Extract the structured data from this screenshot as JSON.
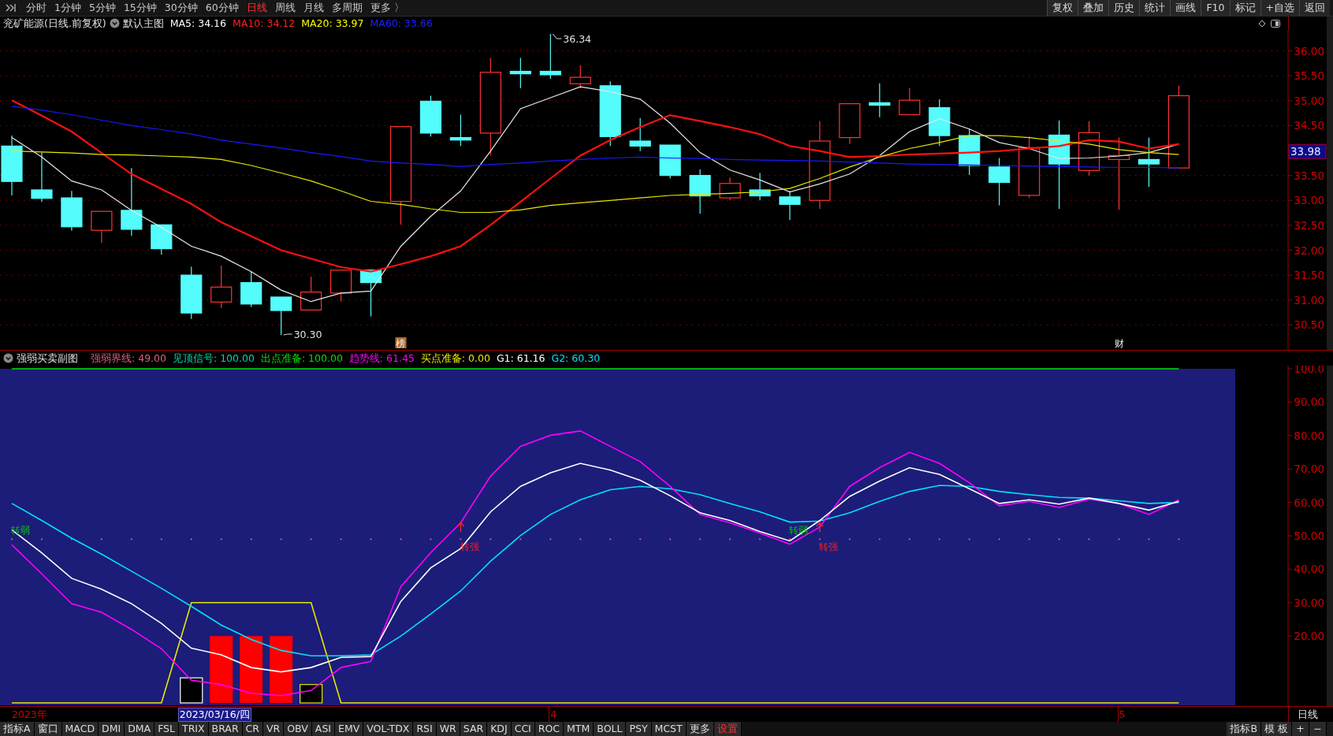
{
  "toolbar": {
    "periods": [
      {
        "label": "分时",
        "selected": false
      },
      {
        "label": "1分钟",
        "selected": false
      },
      {
        "label": "5分钟",
        "selected": false
      },
      {
        "label": "15分钟",
        "selected": false
      },
      {
        "label": "30分钟",
        "selected": false
      },
      {
        "label": "60分钟",
        "selected": false
      },
      {
        "label": "日线",
        "selected": true
      },
      {
        "label": "周线",
        "selected": false
      },
      {
        "label": "月线",
        "selected": false
      },
      {
        "label": "多周期",
        "selected": false
      },
      {
        "label": "更多 〉",
        "selected": false
      }
    ],
    "actions": [
      "复权",
      "叠加",
      "历史",
      "统计",
      "画线",
      "F10",
      "标记",
      "+自选",
      "返回"
    ]
  },
  "info": {
    "title": "兖矿能源(日线.前复权)",
    "template": "默认主图",
    "ma": [
      {
        "label": "MA5: 34.16",
        "color": "#ffffff"
      },
      {
        "label": "MA10: 34.12",
        "color": "#ff2020"
      },
      {
        "label": "MA20: 33.97",
        "color": "#ffff00"
      },
      {
        "label": "MA60: 33.66",
        "color": "#2020ff"
      }
    ]
  },
  "main_chart": {
    "axis_labels": [
      "36.00",
      "35.50",
      "35.00",
      "34.50",
      "33.50",
      "33.00",
      "32.50",
      "32.00",
      "31.50",
      "31.00",
      "30.50"
    ],
    "price_tag": "33.98",
    "high_label": "36.34",
    "low_label": "30.30",
    "event_markers": [
      {
        "kind": "boxed",
        "text": "榜"
      },
      {
        "kind": "plain",
        "text": "财"
      }
    ]
  },
  "indicator": {
    "name": "强弱买卖副图",
    "legend": [
      {
        "label": "强弱界线: 49.00",
        "color": "#e0607a"
      },
      {
        "label": "见顶信号: 100.00",
        "color": "#00d8a8"
      },
      {
        "label": "出点准备: 100.00",
        "color": "#00e000"
      },
      {
        "label": "趋势线: 61.45",
        "color": "#ff00ff"
      },
      {
        "label": "买点准备: 0.00",
        "color": "#e8e800"
      },
      {
        "label": "G1: 61.16",
        "color": "#ffffff"
      },
      {
        "label": "G2: 60.30",
        "color": "#00e0ff"
      }
    ],
    "axis_labels": [
      "100.0",
      "90.00",
      "80.00",
      "70.00",
      "60.00",
      "50.00",
      "40.00",
      "30.00",
      "20.00"
    ],
    "signals": [
      {
        "kind": "weak",
        "text": "转弱"
      },
      {
        "kind": "strong",
        "text": "转强"
      },
      {
        "kind": "weak",
        "text": "转弱"
      },
      {
        "kind": "strong",
        "text": "转强"
      }
    ]
  },
  "date_axis": {
    "labels": [
      "2023年",
      "4",
      "5"
    ],
    "cursor": "2023/03/16/四",
    "period": "日线"
  },
  "bottom_bar": {
    "tabs": [
      "指标A",
      "窗口",
      "MACD",
      "DMI",
      "DMA",
      "FSL",
      "TRIX",
      "BRAR",
      "CR",
      "VR",
      "OBV",
      "ASI",
      "EMV",
      "VOL-TDX",
      "RSI",
      "WR",
      "SAR",
      "KDJ",
      "CCI",
      "ROC",
      "MTM",
      "BOLL",
      "PSY",
      "MCST",
      "更多"
    ],
    "settings": "设置",
    "right_tabs": [
      "指标B",
      "模 板",
      "+",
      "−"
    ]
  }
}
